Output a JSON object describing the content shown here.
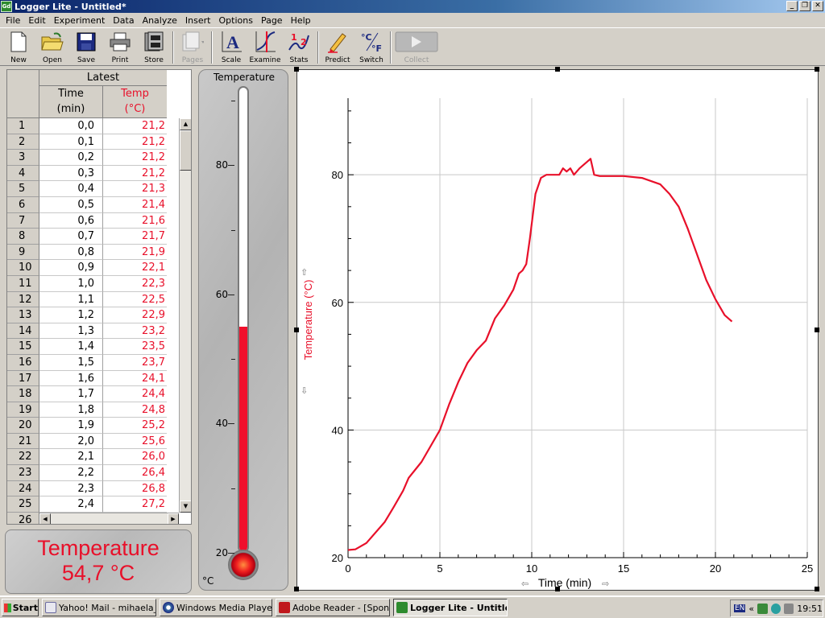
{
  "window": {
    "title": "Logger Lite - Untitled*",
    "app_icon": "Gd",
    "controls": [
      "_",
      "❐",
      "✕"
    ]
  },
  "menu": [
    "File",
    "Edit",
    "Experiment",
    "Data",
    "Analyze",
    "Insert",
    "Options",
    "Page",
    "Help"
  ],
  "toolbar": {
    "new": "New",
    "open": "Open",
    "save": "Save",
    "print": "Print",
    "store": "Store",
    "pages": "Pages",
    "scale": "Scale",
    "examine": "Examine",
    "stats": "Stats",
    "predict": "Predict",
    "switch": "Switch",
    "collect": "Collect"
  },
  "table": {
    "group_header": "Latest",
    "col_time": "Time",
    "col_time_unit": "(min)",
    "col_temp": "Temp",
    "col_temp_unit": "(°C)",
    "rows": [
      [
        "1",
        "0,0",
        "21,2"
      ],
      [
        "2",
        "0,1",
        "21,2"
      ],
      [
        "3",
        "0,2",
        "21,2"
      ],
      [
        "4",
        "0,3",
        "21,2"
      ],
      [
        "5",
        "0,4",
        "21,3"
      ],
      [
        "6",
        "0,5",
        "21,4"
      ],
      [
        "7",
        "0,6",
        "21,6"
      ],
      [
        "8",
        "0,7",
        "21,7"
      ],
      [
        "9",
        "0,8",
        "21,9"
      ],
      [
        "10",
        "0,9",
        "22,1"
      ],
      [
        "11",
        "1,0",
        "22,3"
      ],
      [
        "12",
        "1,1",
        "22,5"
      ],
      [
        "13",
        "1,2",
        "22,9"
      ],
      [
        "14",
        "1,3",
        "23,2"
      ],
      [
        "15",
        "1,4",
        "23,5"
      ],
      [
        "16",
        "1,5",
        "23,7"
      ],
      [
        "17",
        "1,6",
        "24,1"
      ],
      [
        "18",
        "1,7",
        "24,4"
      ],
      [
        "19",
        "1,8",
        "24,8"
      ],
      [
        "20",
        "1,9",
        "25,2"
      ],
      [
        "21",
        "2,0",
        "25,6"
      ],
      [
        "22",
        "2,1",
        "26,0"
      ],
      [
        "23",
        "2,2",
        "26,4"
      ],
      [
        "24",
        "2,3",
        "26,8"
      ],
      [
        "25",
        "2,4",
        "27,2"
      ],
      [
        "26",
        "",
        ""
      ]
    ]
  },
  "meter": {
    "label": "Temperature",
    "reading": "54,7 °C"
  },
  "thermometer": {
    "title": "Temperature",
    "unit": "°C",
    "min": 20,
    "max": 92,
    "value": 54.7,
    "tick_labels": [
      "80",
      "60",
      "40",
      "20"
    ]
  },
  "colors": {
    "accent": "#e8102a",
    "titlebar": "#0a246a"
  },
  "chart_data": {
    "type": "line",
    "xlabel": "Time (min)",
    "ylabel": "Temperature (°C)",
    "xlim": [
      0,
      25
    ],
    "ylim": [
      20,
      92
    ],
    "xticks": [
      0,
      5,
      10,
      15,
      20,
      25
    ],
    "yticks": [
      20,
      40,
      60,
      80
    ],
    "grid": true,
    "series": [
      {
        "color": "#e8102a",
        "x": [
          0,
          0.4,
          1.0,
          2.0,
          2.5,
          3.0,
          3.3,
          4.0,
          5.0,
          5.5,
          6.0,
          6.5,
          7.0,
          7.5,
          8.0,
          8.5,
          9.0,
          9.3,
          9.5,
          9.7,
          9.9,
          10.2,
          10.5,
          10.8,
          11.0,
          11.2,
          11.5,
          11.7,
          11.9,
          12.1,
          12.3,
          12.6,
          13.0,
          13.2,
          13.4,
          13.7,
          14.5,
          15.0,
          16.0,
          17.0,
          17.5,
          18.0,
          18.5,
          19.0,
          19.5,
          20.0,
          20.5,
          20.9
        ],
        "y": [
          21.2,
          21.3,
          22.3,
          25.6,
          28.0,
          30.5,
          32.5,
          35.0,
          40.0,
          44.0,
          47.5,
          50.5,
          52.5,
          54.0,
          57.5,
          59.5,
          62.0,
          64.5,
          65.0,
          66.0,
          70.0,
          77.0,
          79.5,
          80.0,
          80.0,
          80.0,
          80.0,
          81.0,
          80.5,
          81.0,
          80.0,
          81.0,
          82.0,
          82.5,
          80.0,
          79.8,
          79.8,
          79.8,
          79.5,
          78.5,
          77.0,
          75.0,
          71.5,
          67.5,
          63.5,
          60.5,
          58.0,
          57.0
        ]
      }
    ]
  },
  "taskbar": {
    "start": "Start",
    "items": [
      "Yahoo! Mail - mihaela_gar...",
      "Windows Media Player",
      "Adobe Reader - [Sponsori...",
      "Logger Lite - Untitled*"
    ],
    "tray_lang": "EN",
    "tray_chevron": "«",
    "clock": "19:51"
  }
}
